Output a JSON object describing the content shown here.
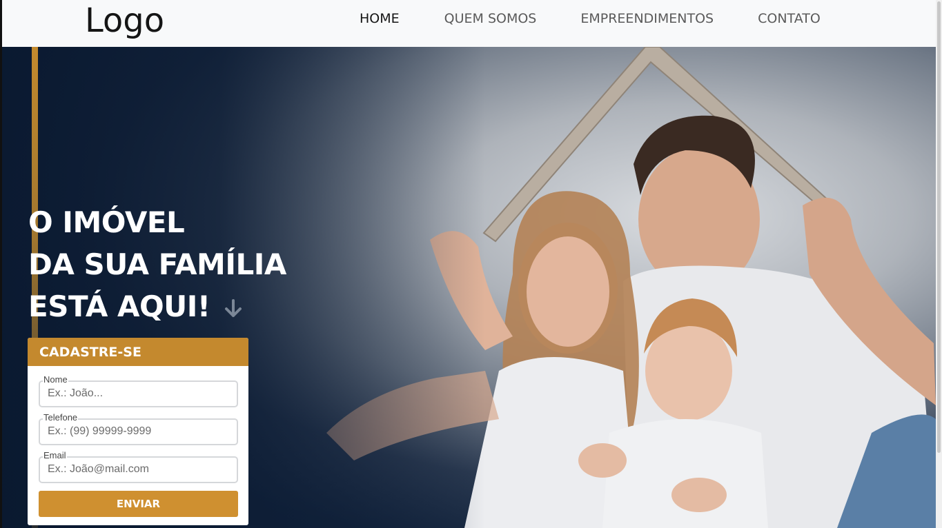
{
  "header": {
    "logo": "Logo",
    "nav": [
      {
        "label": "HOME",
        "active": true
      },
      {
        "label": "QUEM SOMOS",
        "active": false
      },
      {
        "label": "EMPREENDIMENTOS",
        "active": false
      },
      {
        "label": "CONTATO",
        "active": false
      }
    ]
  },
  "hero": {
    "headline_lines": [
      "O IMÓVEL",
      "DA SUA FAMÍLIA",
      "ESTÁ AQUI!"
    ],
    "arrow_icon": "arrow-down-icon",
    "photo": "family-under-cardboard-roof-photo"
  },
  "form": {
    "title": "CADASTRE-SE",
    "fields": [
      {
        "label": "Nome",
        "placeholder": "Ex.: João..."
      },
      {
        "label": "Telefone",
        "placeholder": "Ex.: (99) 99999-9999"
      },
      {
        "label": "Email",
        "placeholder": "Ex.: João@mail.com"
      }
    ],
    "submit_label": "ENVIAR"
  },
  "colors": {
    "accent_gold": "#c4892e",
    "button_gold": "#cf9030",
    "hero_navy": "#0d1c33",
    "header_bg": "#f8f9fa"
  }
}
